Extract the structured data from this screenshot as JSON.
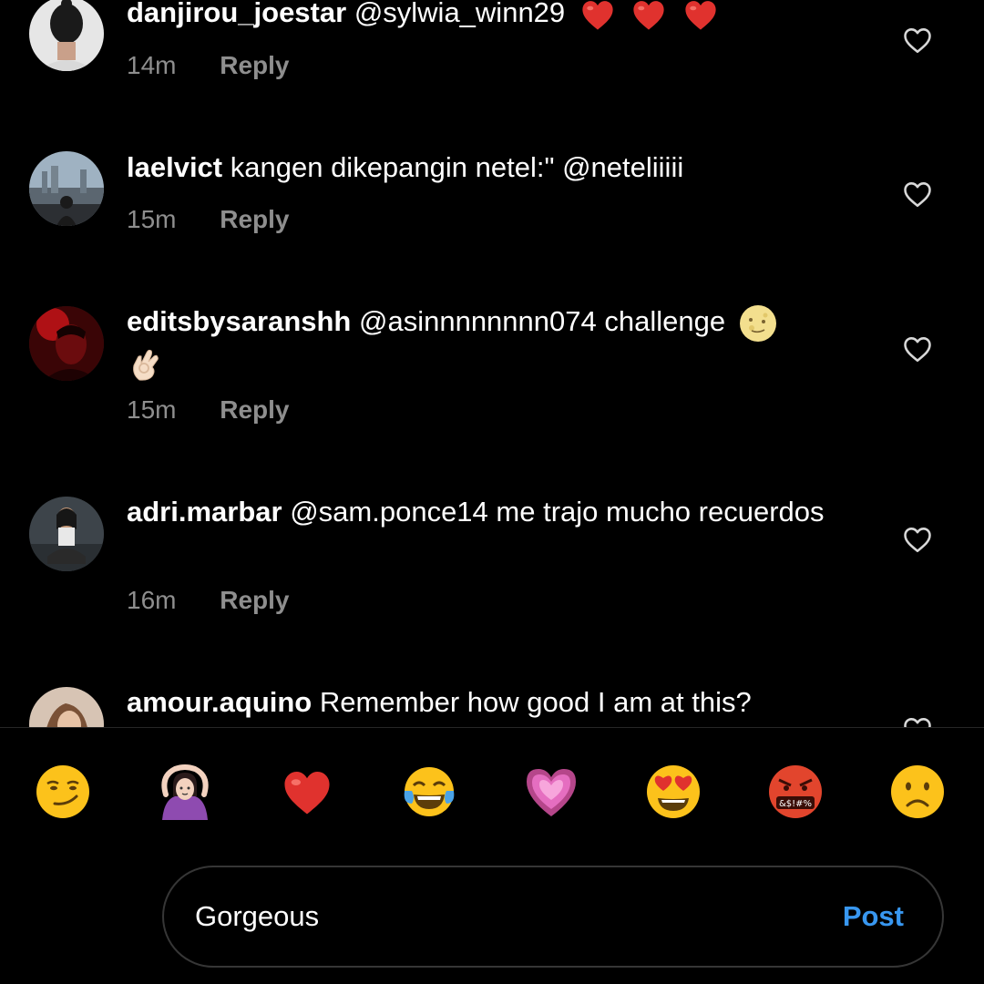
{
  "comments": [
    {
      "username": "danjirou_joestar",
      "text": "@sylwia_winn29",
      "emojis": [
        "red-heart",
        "red-heart",
        "red-heart"
      ],
      "time": "14m",
      "reply": "Reply"
    },
    {
      "username": "laelvict",
      "text": "kangen dikepangin netel:\" @neteliiiii",
      "time": "15m",
      "reply": "Reply"
    },
    {
      "username": "editsbysaranshh",
      "text": "@asinnnnnnnn074 challenge",
      "emojis": [
        "full-moon-face",
        "ok-hand"
      ],
      "time": "15m",
      "reply": "Reply"
    },
    {
      "username": "adri.marbar",
      "text": "@sam.ponce14 me trajo mucho recuerdos",
      "time": "16m",
      "reply": "Reply"
    },
    {
      "username": "amour.aquino",
      "text": "Remember how good I am at this?"
    }
  ],
  "emoji_bar": [
    "smirking-face",
    "woman-gesturing-ok",
    "red-heart",
    "face-with-tears-of-joy",
    "growing-heart",
    "heart-eyes-face",
    "face-with-symbols-on-mouth",
    "frowning-face"
  ],
  "composer": {
    "value": "Gorgeous",
    "post_label": "Post"
  },
  "colors": {
    "background": "#000000",
    "secondary_text": "#8e8e8e",
    "accent": "#3897f0"
  }
}
